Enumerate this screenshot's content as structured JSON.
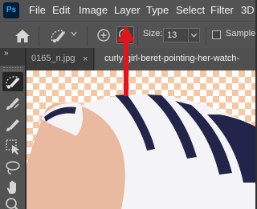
{
  "app": {
    "logo_text": "Ps"
  },
  "menu": [
    "File",
    "Edit",
    "Image",
    "Layer",
    "Type",
    "Select",
    "Filter",
    "3D"
  ],
  "options_bar": {
    "home_icon": "home-icon",
    "size_label": "Size:",
    "size_value": "13",
    "sample_label": "Sample A"
  },
  "tabs": [
    {
      "label": "0165_n.jpg",
      "close": "×",
      "active": false
    },
    {
      "label": "curly-girl-beret-pointing-her-watch-",
      "active": true
    }
  ],
  "toolbar_collapse": "»",
  "tools": [
    {
      "name": "quick-selection-brush-icon",
      "active": true
    },
    {
      "name": "brush-icon",
      "active": false
    },
    {
      "name": "eraser-brush-icon",
      "active": false
    },
    {
      "name": "rectangle-select-icon",
      "active": false
    },
    {
      "name": "lasso-icon",
      "active": false
    },
    {
      "name": "hand-icon",
      "active": false
    },
    {
      "name": "zoom-icon",
      "active": false
    }
  ],
  "colors": {
    "menubar": "#535353",
    "annotation_arrow": "#e5141c",
    "checker": "#f6c7a2",
    "stripe_navy": "#222549",
    "skin": "#e9b9a0"
  }
}
